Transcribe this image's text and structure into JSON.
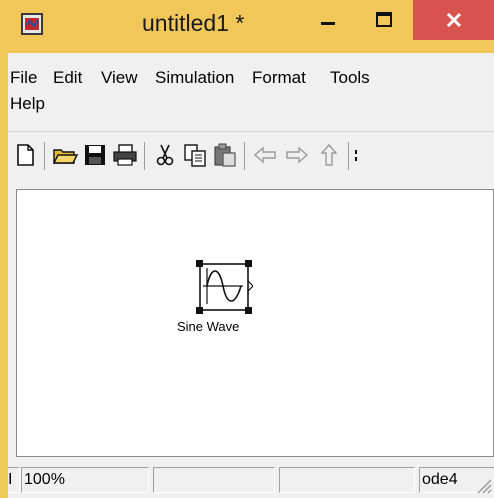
{
  "window": {
    "title": "untitled1 *",
    "accent_color": "#f2c75a",
    "close_color": "#d9534e"
  },
  "menubar": {
    "items": [
      "File",
      "Edit",
      "View",
      "Simulation",
      "Format",
      "Tools",
      "Help"
    ]
  },
  "toolbar": {
    "buttons": [
      "new-icon",
      "open-icon",
      "save-icon",
      "print-icon",
      "cut-icon",
      "copy-icon",
      "paste-icon",
      "back-icon",
      "forward-icon",
      "up-icon"
    ]
  },
  "canvas": {
    "block": {
      "label": "Sine Wave",
      "icon": "sine-wave-icon"
    }
  },
  "statusbar": {
    "first": "I",
    "zoom": "100%",
    "cell2": "",
    "cell3": "",
    "solver": "ode4"
  }
}
